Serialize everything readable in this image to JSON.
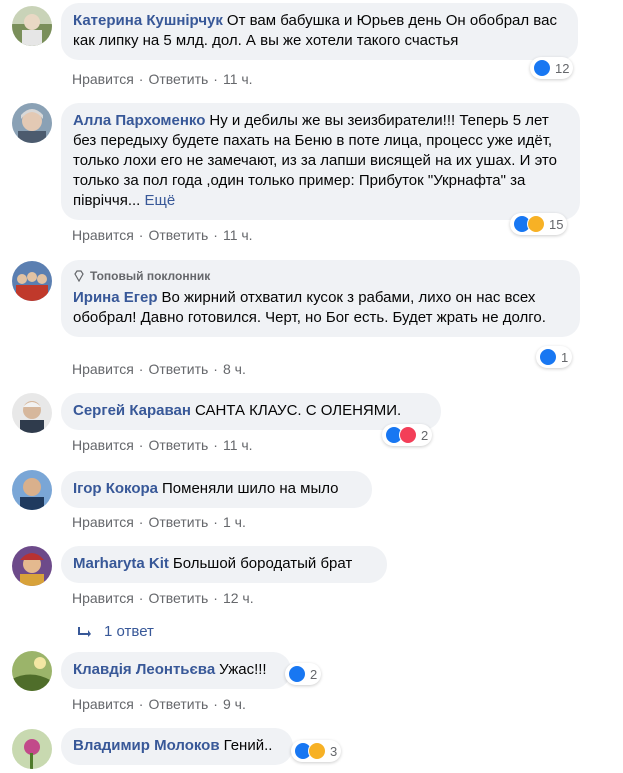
{
  "comments": [
    {
      "author": "Катерина Кушнірчук",
      "text": "От вам бабушка и Юрьев день Он обобрал вас как липку на 5 млд. дол. А вы же хотели такого счастья",
      "like": "Нравится",
      "reply": "Ответить",
      "time": "11 ч.",
      "reaction_count": "12"
    },
    {
      "author": "Алла Пархоменко",
      "text": "Ну и дебилы же вы зеизбиратели!!! Теперь 5 лет без передыху будете пахать на Беню в поте лица, процесс уже идёт, только лохи его не замечают, из за лапши висящей на их ушах. И это только за пол года ,один только пример: Прибуток \"Укрнафта\" за півріччя...",
      "more": "Ещё",
      "like": "Нравится",
      "reply": "Ответить",
      "time": "11 ч.",
      "reaction_count": "15"
    },
    {
      "badge": "Топовый поклонник",
      "author": "Ирина Егер",
      "text": "Во жирний отхватил кусок з рабами, лихо он нас всех обобрал! Давно готовился. Черт, но Бог есть. Будет жрать не долго.",
      "like": "Нравится",
      "reply": "Ответить",
      "time": "8 ч.",
      "reaction_count": "1"
    },
    {
      "author": "Сергей Караван",
      "text": "САНТА КЛАУС. С ОЛЕНЯМИ.",
      "like": "Нравится",
      "reply": "Ответить",
      "time": "11 ч.",
      "reaction_count": "2"
    },
    {
      "author": "Ігор Кокора",
      "text": "Поменяли шило на мыло",
      "like": "Нравится",
      "reply": "Ответить",
      "time": "1 ч."
    },
    {
      "author": "Marharyta Kit",
      "text": "Большой бородатый брат",
      "like": "Нравится",
      "reply": "Ответить",
      "time": "12 ч.",
      "replies_label": "1 ответ"
    },
    {
      "author": "Клавдія Леонтьєва",
      "text": "Ужас!!!",
      "like": "Нравится",
      "reply": "Ответить",
      "time": "9 ч.",
      "reaction_count": "2"
    },
    {
      "author": "Владимир Молоков",
      "text": "Гений..",
      "reaction_count": "3"
    }
  ],
  "separator": "·",
  "icons": {
    "reply_arrow": "reply-arrow-icon",
    "badge": "diamond-icon"
  },
  "colors": {
    "like": "#1877f2",
    "love": "#f33e58",
    "sad": "#f7b125",
    "link": "#385898",
    "bubble": "#f0f2f5",
    "meta": "#65676b"
  }
}
